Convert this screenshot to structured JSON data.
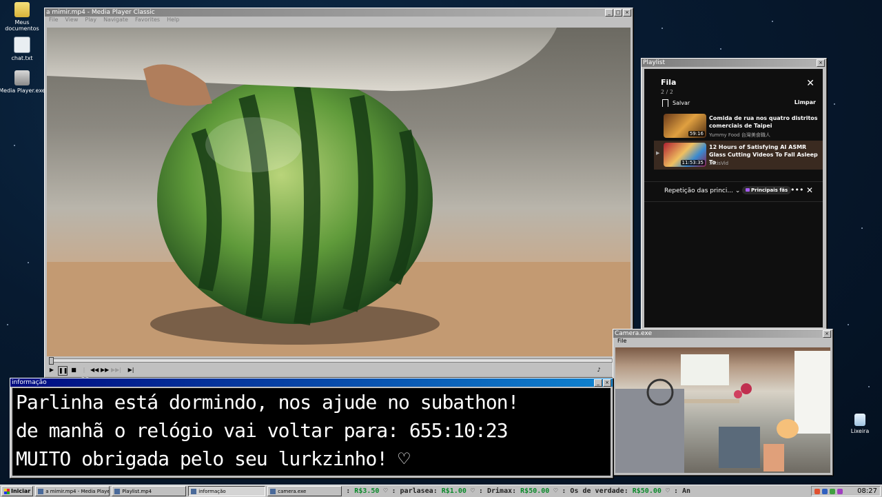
{
  "desktop": {
    "icons": [
      {
        "label": "Meus documentos",
        "icon": "folder-icon"
      },
      {
        "label": "chat.txt",
        "icon": "text-file-icon"
      },
      {
        "label": "Media Player.exe",
        "icon": "media-player-icon"
      },
      {
        "label": "Lixeira",
        "icon": "recycle-bin-icon"
      }
    ]
  },
  "media_player": {
    "title": "a mimir.mp4 - Media Player Classic",
    "menu": [
      "File",
      "View",
      "Play",
      "Navigate",
      "Favorites",
      "Help"
    ],
    "window_buttons": [
      "_",
      "□",
      "×"
    ]
  },
  "playlist": {
    "window_title": "Playlist",
    "queue_title": "Fila",
    "queue_count": "2 / 2",
    "save_label": "Salvar",
    "clear_label": "Limpar",
    "items": [
      {
        "title": "Comida de rua nos quatro distritos comerciais de Taipei",
        "channel": "Yummy Food 台灣美食職人",
        "duration": "59:16"
      },
      {
        "title": "12 Hours of Satisfying AI ASMR Glass Cutting Videos To Fall Asleep To",
        "channel": "SatisVid",
        "duration": "11:53:35"
      }
    ],
    "repeat_label": "Repetição das princi...",
    "chip_label": "Principais fãs"
  },
  "camera": {
    "title": "Camera.exe",
    "menu": [
      "File"
    ]
  },
  "info": {
    "title": "informação",
    "lines": [
      "Parlinha está dormindo, nos ajude no subathon!",
      "de manhã o relógio vai voltar para:  655:10:23",
      "MUITO obrigada pelo seu lurkzinho! ♡"
    ]
  },
  "taskbar": {
    "start_label": "Iniciar",
    "tasks": [
      "a mimir.mp4 - Media Player...",
      "Playlist.mp4",
      "informação",
      "camera.exe"
    ],
    "ticker": [
      {
        "name": "",
        "amount": "R$3.50"
      },
      {
        "name": "parlasea",
        "amount": "R$1.00"
      },
      {
        "name": "Drimax",
        "amount": "R$50.00"
      },
      {
        "name": "Os de verdade",
        "amount": "R$50.00"
      },
      {
        "name": "An",
        "amount": ""
      }
    ],
    "clock": "08:27"
  }
}
